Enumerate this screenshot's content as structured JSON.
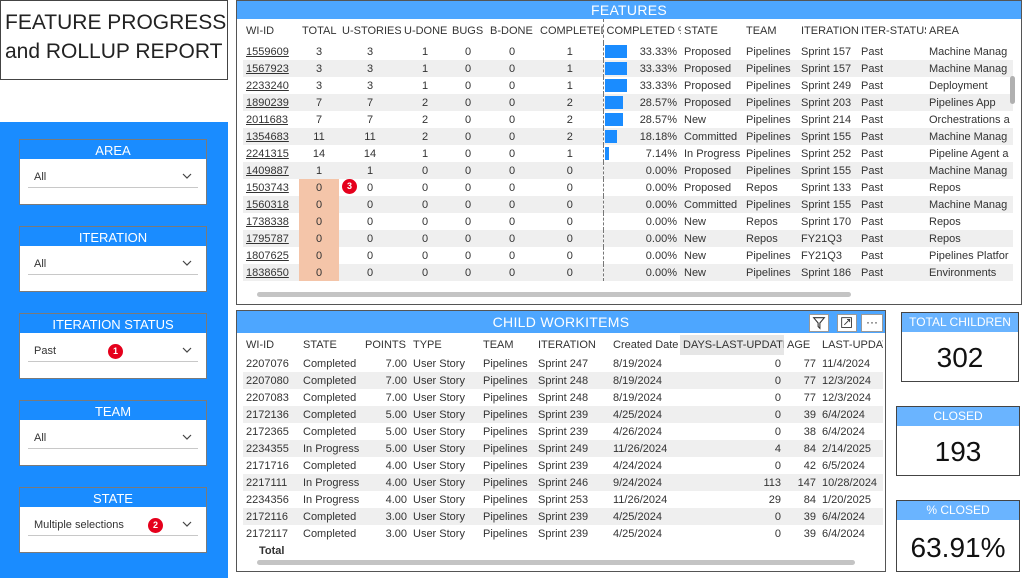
{
  "report": {
    "title_line1": "FEATURE PROGRESS",
    "title_line2": "and ROLLUP REPORT"
  },
  "slicers": [
    {
      "title": "AREA",
      "value": "All"
    },
    {
      "title": "ITERATION",
      "value": "All"
    },
    {
      "title": "ITERATION STATUS",
      "value": "Past",
      "badge": "1"
    },
    {
      "title": "TEAM",
      "value": "All"
    },
    {
      "title": "STATE",
      "value": "Multiple selections",
      "badge": "2"
    }
  ],
  "features": {
    "title": "FEATURES",
    "badge": "3",
    "columns": [
      "WI-ID",
      "TOTAL",
      "U-STORIES",
      "U-DONE",
      "BUGS",
      "B-DONE",
      "COMPLETED",
      "COMPLETED %",
      "STATE",
      "TEAM",
      "ITERATION",
      "ITER-STATUS",
      "AREA"
    ],
    "rows": [
      [
        "1559609",
        "3",
        "3",
        "1",
        "0",
        "0",
        "1",
        "33.33%",
        "Proposed",
        "Pipelines",
        "Sprint 157",
        "Past",
        "Machine Manag"
      ],
      [
        "1567923",
        "3",
        "3",
        "1",
        "0",
        "0",
        "1",
        "33.33%",
        "Proposed",
        "Pipelines",
        "Sprint 157",
        "Past",
        "Machine Manag"
      ],
      [
        "2233240",
        "3",
        "3",
        "1",
        "0",
        "0",
        "1",
        "33.33%",
        "Proposed",
        "Pipelines",
        "Sprint 249",
        "Past",
        "Deployment"
      ],
      [
        "1890239",
        "7",
        "7",
        "2",
        "0",
        "0",
        "2",
        "28.57%",
        "Proposed",
        "Pipelines",
        "Sprint 203",
        "Past",
        "Pipelines App"
      ],
      [
        "2011683",
        "7",
        "7",
        "2",
        "0",
        "0",
        "2",
        "28.57%",
        "New",
        "Pipelines",
        "Sprint 214",
        "Past",
        "Orchestrations a"
      ],
      [
        "1354683",
        "11",
        "11",
        "2",
        "0",
        "0",
        "2",
        "18.18%",
        "Committed",
        "Pipelines",
        "Sprint 155",
        "Past",
        "Machine Manag"
      ],
      [
        "2241315",
        "14",
        "14",
        "1",
        "0",
        "0",
        "1",
        "7.14%",
        "In Progress",
        "Pipelines",
        "Sprint 252",
        "Past",
        "Pipeline Agent a"
      ],
      [
        "1409887",
        "1",
        "1",
        "0",
        "0",
        "0",
        "0",
        "0.00%",
        "Proposed",
        "Pipelines",
        "Sprint 155",
        "Past",
        "Machine Manag"
      ],
      [
        "1503743",
        "0",
        "0",
        "0",
        "0",
        "0",
        "0",
        "0.00%",
        "Proposed",
        "Repos",
        "Sprint 133",
        "Past",
        "Repos"
      ],
      [
        "1560318",
        "0",
        "0",
        "0",
        "0",
        "0",
        "0",
        "0.00%",
        "Committed",
        "Pipelines",
        "Sprint 155",
        "Past",
        "Machine Manag"
      ],
      [
        "1738338",
        "0",
        "0",
        "0",
        "0",
        "0",
        "0",
        "0.00%",
        "New",
        "Repos",
        "Sprint 170",
        "Past",
        "Repos"
      ],
      [
        "1795787",
        "0",
        "0",
        "0",
        "0",
        "0",
        "0",
        "0.00%",
        "New",
        "Repos",
        "FY21Q3",
        "Past",
        "Repos"
      ],
      [
        "1807625",
        "0",
        "0",
        "0",
        "0",
        "0",
        "0",
        "0.00%",
        "New",
        "Pipelines",
        "FY21Q3",
        "Past",
        "Pipelines Platfor"
      ],
      [
        "1838650",
        "0",
        "0",
        "0",
        "0",
        "0",
        "0",
        "0.00%",
        "New",
        "Pipelines",
        "Sprint 186",
        "Past",
        "Environments"
      ]
    ],
    "completed_pct_values": [
      33.33,
      33.33,
      33.33,
      28.57,
      28.57,
      18.18,
      7.14,
      0,
      0,
      0,
      0,
      0,
      0,
      0
    ]
  },
  "child": {
    "title": "CHILD WORKITEMS",
    "columns": [
      "WI-ID",
      "STATE",
      "POINTS",
      "TYPE",
      "TEAM",
      "ITERATION",
      "Created Date",
      "DAYS-LAST-UPDATE",
      "AGE",
      "LAST-UPDAT"
    ],
    "rows": [
      [
        "2207076",
        "Completed",
        "7.00",
        "User Story",
        "Pipelines",
        "Sprint 247",
        "8/19/2024",
        "0",
        "77",
        "11/4/2024"
      ],
      [
        "2207080",
        "Completed",
        "7.00",
        "User Story",
        "Pipelines",
        "Sprint 248",
        "8/19/2024",
        "0",
        "77",
        "12/3/2024"
      ],
      [
        "2207083",
        "Completed",
        "7.00",
        "User Story",
        "Pipelines",
        "Sprint 248",
        "8/19/2024",
        "0",
        "77",
        "12/3/2024"
      ],
      [
        "2172136",
        "Completed",
        "5.00",
        "User Story",
        "Pipelines",
        "Sprint 239",
        "4/25/2024",
        "0",
        "39",
        "6/4/2024"
      ],
      [
        "2172365",
        "Completed",
        "5.00",
        "User Story",
        "Pipelines",
        "Sprint 239",
        "4/26/2024",
        "0",
        "38",
        "6/4/2024"
      ],
      [
        "2234355",
        "In Progress",
        "5.00",
        "User Story",
        "Pipelines",
        "Sprint 249",
        "11/26/2024",
        "4",
        "84",
        "2/14/2025"
      ],
      [
        "2171716",
        "Completed",
        "4.00",
        "User Story",
        "Pipelines",
        "Sprint 239",
        "4/24/2024",
        "0",
        "42",
        "6/5/2024"
      ],
      [
        "2217111",
        "In Progress",
        "4.00",
        "User Story",
        "Pipelines",
        "Sprint 246",
        "9/24/2024",
        "113",
        "147",
        "10/28/2024"
      ],
      [
        "2234356",
        "In Progress",
        "4.00",
        "User Story",
        "Pipelines",
        "Sprint 253",
        "11/26/2024",
        "29",
        "84",
        "1/20/2025"
      ],
      [
        "2172116",
        "Completed",
        "3.00",
        "User Story",
        "Pipelines",
        "Sprint 239",
        "4/25/2024",
        "0",
        "39",
        "6/4/2024"
      ],
      [
        "2172117",
        "Completed",
        "3.00",
        "User Story",
        "Pipelines",
        "Sprint 239",
        "4/25/2024",
        "0",
        "39",
        "6/4/2024"
      ]
    ],
    "total_label": "Total"
  },
  "kpis": [
    {
      "title": "TOTAL CHILDREN",
      "value": "302"
    },
    {
      "title": "CLOSED",
      "value": "193"
    },
    {
      "title": "% CLOSED",
      "value": "63.91%"
    }
  ],
  "icons": {
    "filter": "filter-icon",
    "focus": "focus-mode-icon",
    "more": "more-options-icon"
  },
  "colors": {
    "accent": "#1a8cff",
    "header": "#4da6ff",
    "highlight": "#f4c5a9",
    "badge": "#e5001c"
  }
}
